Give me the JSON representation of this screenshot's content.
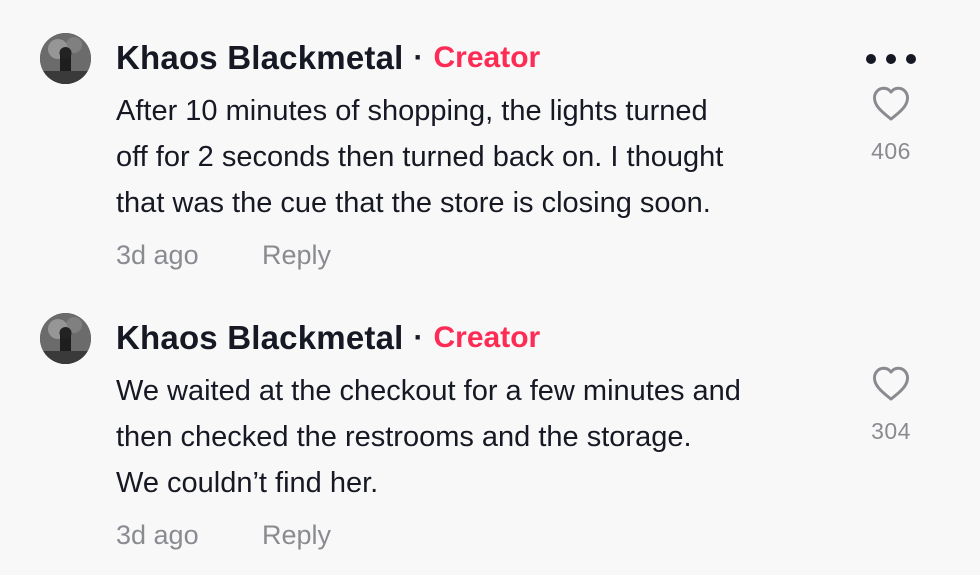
{
  "comments": [
    {
      "author": "Khaos Blackmetal",
      "separator": "·",
      "badge": "Creator",
      "text_lines": [
        "After 10 minutes of shopping, the lights turned",
        "off for 2 seconds then turned back on. I thought",
        "that was the cue that the store is closing soon."
      ],
      "time": "3d ago",
      "reply_label": "Reply",
      "like_count": "406",
      "like_icon": "heart-outline-icon",
      "more_icon": "more-horizontal-icon"
    },
    {
      "author": "Khaos Blackmetal",
      "separator": "·",
      "badge": "Creator",
      "text_lines": [
        "We waited at the checkout for a few minutes and",
        "then checked the restrooms and the storage.",
        "We couldn’t find her."
      ],
      "time": "3d ago",
      "reply_label": "Reply",
      "like_count": "304",
      "like_icon": "heart-outline-icon"
    }
  ],
  "colors": {
    "background": "#f8f8f8",
    "text": "#161823",
    "creator_badge": "#fe2c55",
    "muted": "#8a8b91"
  }
}
